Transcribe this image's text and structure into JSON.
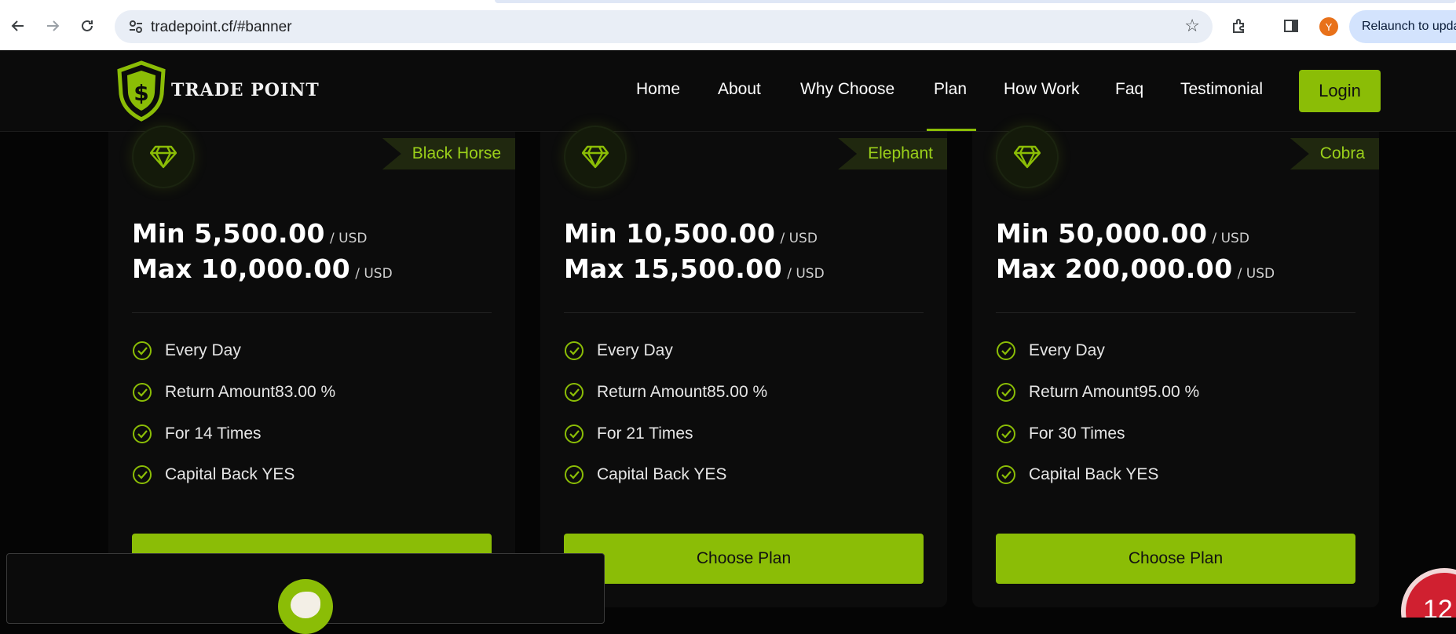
{
  "browser": {
    "url": "tradepoint.cf/#banner",
    "profile_initial": "Y",
    "relaunch_label": "Relaunch to update"
  },
  "header": {
    "brand": "TRADE POINT",
    "nav": [
      {
        "label": "Home"
      },
      {
        "label": "About"
      },
      {
        "label": "Why Choose"
      },
      {
        "label": "Plan"
      },
      {
        "label": "How Work"
      },
      {
        "label": "Faq"
      },
      {
        "label": "Testimonial"
      }
    ],
    "active_nav": "Plan",
    "login_label": "Login",
    "accent_color": "#8bbd06"
  },
  "plans": [
    {
      "name": "Black Horse",
      "min_label": "Min",
      "min": "5,500.00",
      "max_label": "Max",
      "max": "10,000.00",
      "unit": "/ USD",
      "features": [
        "Every Day",
        "Return Amount83.00 %",
        "For 14 Times",
        "Capital Back YES"
      ],
      "button": ""
    },
    {
      "name": "Elephant",
      "min_label": "Min",
      "min": "10,500.00",
      "max_label": "Max",
      "max": "15,500.00",
      "unit": "/ USD",
      "features": [
        "Every Day",
        "Return Amount85.00 %",
        "For 21 Times",
        "Capital Back YES"
      ],
      "button": "Choose Plan"
    },
    {
      "name": "Cobra",
      "min_label": "Min",
      "min": "50,000.00",
      "max_label": "Max",
      "max": "200,000.00",
      "unit": "/ USD",
      "features": [
        "Every Day",
        "Return Amount95.00 %",
        "For 30 Times",
        "Capital Back YES"
      ],
      "button": "Choose Plan"
    }
  ],
  "notification": {
    "count": "12"
  }
}
